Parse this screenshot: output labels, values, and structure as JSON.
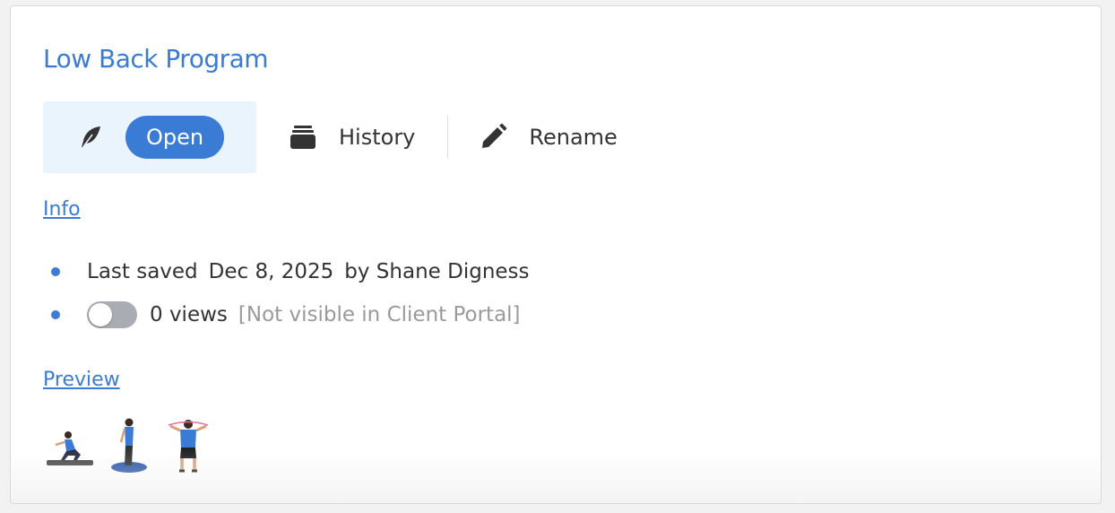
{
  "program": {
    "title": "Low Back Program"
  },
  "actions": {
    "open_label": "Open",
    "history_label": "History",
    "rename_label": "Rename"
  },
  "info": {
    "link_label": "Info",
    "last_saved_label": "Last saved",
    "last_saved_date": "Dec 8, 2025",
    "saved_by": "by Shane Digness",
    "views": "0 views",
    "portal_status": "[Not visible in Client Portal]",
    "portal_visible": false
  },
  "preview": {
    "link_label": "Preview",
    "thumbnails": [
      "squat-exercise-thumbnail",
      "standing-balance-exercise-thumbnail",
      "band-pull-exercise-thumbnail"
    ]
  },
  "colors": {
    "accent": "#3a7bd5",
    "open_bg": "#eaf4fd",
    "muted": "#9a9a9a"
  },
  "icons": {
    "open": "feather-icon",
    "history": "stack-icon",
    "rename": "pencil-icon"
  }
}
